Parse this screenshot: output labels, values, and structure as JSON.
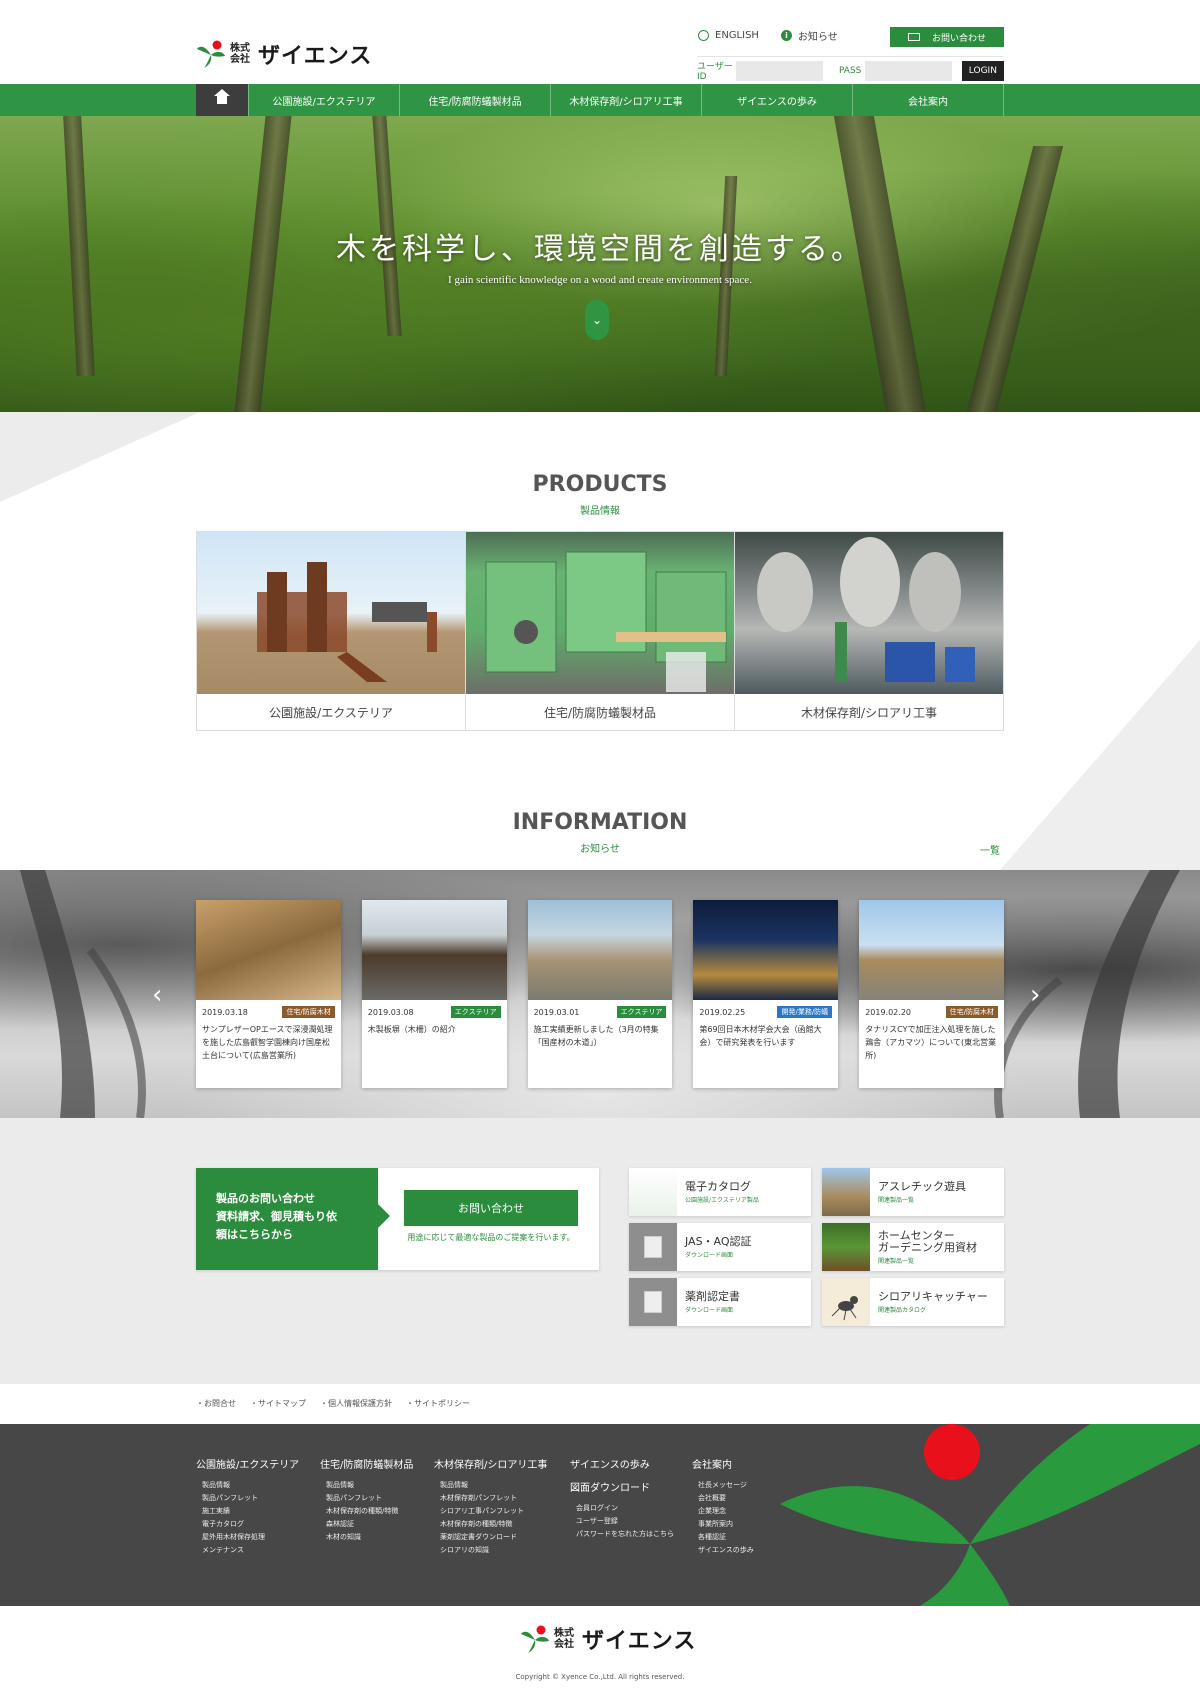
{
  "header": {
    "logo_small": "株式\n会社",
    "logo_name": "ザイエンス",
    "english": "ENGLISH",
    "notice": "お知らせ",
    "contact": "お問い合わせ",
    "user_id_label": "ユーザーID",
    "pass_label": "PASS",
    "login": "LOGIN"
  },
  "nav": {
    "items": [
      "公園施設/エクステリア",
      "住宅/防腐防蟻製材品",
      "木材保存剤/シロアリ工事",
      "ザイエンスの歩み",
      "会社案内"
    ]
  },
  "hero": {
    "title": "木を科学し、環境空間を創造する。",
    "subtitle": "I gain scientific knowledge on a wood and create environment space.",
    "down": "⌄"
  },
  "products": {
    "title": "PRODUCTS",
    "subtitle": "製品情報",
    "items": [
      {
        "label": "公園施設/エクステリア"
      },
      {
        "label": "住宅/防腐防蟻製材品"
      },
      {
        "label": "木材保存剤/シロアリ工事"
      }
    ]
  },
  "information": {
    "title": "INFORMATION",
    "subtitle": "お知らせ",
    "more": "一覧",
    "items": [
      {
        "date": "2019.03.18",
        "tag": "住宅/防腐木材",
        "tag_color": "#8b5a2b",
        "text": "サンプレザーOPエースで深浸潤処理を施した広島叡智学園棟向け国産松土台について(広島営業所)"
      },
      {
        "date": "2019.03.08",
        "tag": "エクステリア",
        "tag_color": "#2c8c3d",
        "text": "木製板塀（木柵）の紹介"
      },
      {
        "date": "2019.03.01",
        "tag": "エクステリア",
        "tag_color": "#2c8c3d",
        "text": "施工実績更新しました（3月の特集「国産材の木道」）"
      },
      {
        "date": "2019.02.25",
        "tag": "開発/業務/防蟻",
        "tag_color": "#2a76c8",
        "text": "第69回日本木材学会大会（函館大会）で研究発表を行います"
      },
      {
        "date": "2019.02.20",
        "tag": "住宅/防腐木材",
        "tag_color": "#8b5a2b",
        "text": "タナリスCYで加圧注入処理を施した鶏舎（アカマツ）について(東北営業所)"
      }
    ]
  },
  "contact": {
    "lead": "製品のお問い合わせ\n資料請求、御見積もり依\n頼はこちらから",
    "button": "お問い合わせ",
    "note": "用途に応じて最適な製品のご提案を行います。"
  },
  "links": [
    {
      "title": "電子カタログ",
      "sub": "公園施設/エクステリア製品"
    },
    {
      "title": "アスレチック遊具",
      "sub": "関連製品一覧"
    },
    {
      "title": "JAS・AQ認証",
      "sub": "ダウンロード画面"
    },
    {
      "title": "ホームセンター\nガーデニング用資材",
      "sub": "関連製品一覧"
    },
    {
      "title": "薬剤認定書",
      "sub": "ダウンロード画面"
    },
    {
      "title": "シロアリキャッチャー",
      "sub": "関連製品カタログ"
    }
  ],
  "footer_links": [
    "・お問合せ",
    "・サイトマップ",
    "・個人情報保護方針",
    "・サイトポリシー"
  ],
  "footer": {
    "cols": [
      {
        "heading": "公園施設/エクステリア",
        "items": [
          "製品情報",
          "製品パンフレット",
          "施工実績",
          "電子カタログ",
          "屋外用木材保存処理",
          "メンテナンス"
        ]
      },
      {
        "heading": "住宅/防腐防蟻製材品",
        "items": [
          "製品情報",
          "製品パンフレット",
          "木材保存剤の種類/特徴",
          "森林認証",
          "木材の知識"
        ]
      },
      {
        "heading": "木材保存剤/シロアリ工事",
        "items": [
          "製品情報",
          "木材保存剤パンフレット",
          "シロアリ工事パンフレット",
          "木材保存剤の種類/特徴",
          "薬剤認定書ダウンロード",
          "シロアリの知識"
        ]
      },
      {
        "heading": "ザイエンスの歩み",
        "heading2": "図面ダウンロード",
        "items": [
          "会員ログイン",
          "ユーザー登録",
          "パスワードを忘れた方はこちら"
        ]
      },
      {
        "heading": "会社案内",
        "items": [
          "社長メッセージ",
          "会社概要",
          "企業理念",
          "事業所案内",
          "各種認証",
          "ザイエンスの歩み"
        ]
      }
    ],
    "copyright": "Copyright © Xyence Co.,Ltd. All rights reserved."
  },
  "colors": {
    "brand_green": "#2c8c3d",
    "nav_green": "#2f9443",
    "footer_gray": "#474747",
    "logo_red": "#e8101b"
  }
}
